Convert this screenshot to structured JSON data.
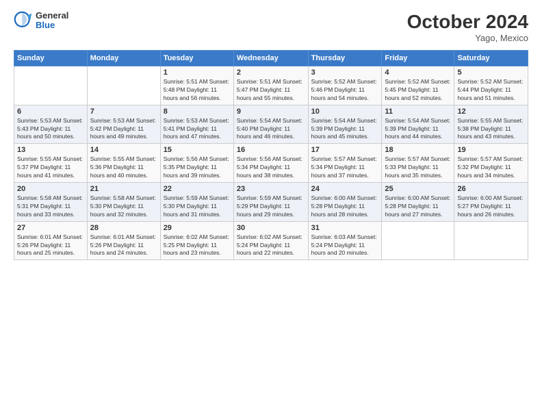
{
  "logo": {
    "general": "General",
    "blue": "Blue"
  },
  "header": {
    "month": "October 2024",
    "location": "Yago, Mexico"
  },
  "weekdays": [
    "Sunday",
    "Monday",
    "Tuesday",
    "Wednesday",
    "Thursday",
    "Friday",
    "Saturday"
  ],
  "weeks": [
    [
      {
        "day": null,
        "info": null
      },
      {
        "day": null,
        "info": null
      },
      {
        "day": "1",
        "info": "Sunrise: 5:51 AM\nSunset: 5:48 PM\nDaylight: 11 hours and 56 minutes."
      },
      {
        "day": "2",
        "info": "Sunrise: 5:51 AM\nSunset: 5:47 PM\nDaylight: 11 hours and 55 minutes."
      },
      {
        "day": "3",
        "info": "Sunrise: 5:52 AM\nSunset: 5:46 PM\nDaylight: 11 hours and 54 minutes."
      },
      {
        "day": "4",
        "info": "Sunrise: 5:52 AM\nSunset: 5:45 PM\nDaylight: 11 hours and 52 minutes."
      },
      {
        "day": "5",
        "info": "Sunrise: 5:52 AM\nSunset: 5:44 PM\nDaylight: 11 hours and 51 minutes."
      }
    ],
    [
      {
        "day": "6",
        "info": "Sunrise: 5:53 AM\nSunset: 5:43 PM\nDaylight: 11 hours and 50 minutes."
      },
      {
        "day": "7",
        "info": "Sunrise: 5:53 AM\nSunset: 5:42 PM\nDaylight: 11 hours and 49 minutes."
      },
      {
        "day": "8",
        "info": "Sunrise: 5:53 AM\nSunset: 5:41 PM\nDaylight: 11 hours and 47 minutes."
      },
      {
        "day": "9",
        "info": "Sunrise: 5:54 AM\nSunset: 5:40 PM\nDaylight: 11 hours and 46 minutes."
      },
      {
        "day": "10",
        "info": "Sunrise: 5:54 AM\nSunset: 5:39 PM\nDaylight: 11 hours and 45 minutes."
      },
      {
        "day": "11",
        "info": "Sunrise: 5:54 AM\nSunset: 5:39 PM\nDaylight: 11 hours and 44 minutes."
      },
      {
        "day": "12",
        "info": "Sunrise: 5:55 AM\nSunset: 5:38 PM\nDaylight: 11 hours and 43 minutes."
      }
    ],
    [
      {
        "day": "13",
        "info": "Sunrise: 5:55 AM\nSunset: 5:37 PM\nDaylight: 11 hours and 41 minutes."
      },
      {
        "day": "14",
        "info": "Sunrise: 5:55 AM\nSunset: 5:36 PM\nDaylight: 11 hours and 40 minutes."
      },
      {
        "day": "15",
        "info": "Sunrise: 5:56 AM\nSunset: 5:35 PM\nDaylight: 11 hours and 39 minutes."
      },
      {
        "day": "16",
        "info": "Sunrise: 5:56 AM\nSunset: 5:34 PM\nDaylight: 11 hours and 38 minutes."
      },
      {
        "day": "17",
        "info": "Sunrise: 5:57 AM\nSunset: 5:34 PM\nDaylight: 11 hours and 37 minutes."
      },
      {
        "day": "18",
        "info": "Sunrise: 5:57 AM\nSunset: 5:33 PM\nDaylight: 11 hours and 35 minutes."
      },
      {
        "day": "19",
        "info": "Sunrise: 5:57 AM\nSunset: 5:32 PM\nDaylight: 11 hours and 34 minutes."
      }
    ],
    [
      {
        "day": "20",
        "info": "Sunrise: 5:58 AM\nSunset: 5:31 PM\nDaylight: 11 hours and 33 minutes."
      },
      {
        "day": "21",
        "info": "Sunrise: 5:58 AM\nSunset: 5:30 PM\nDaylight: 11 hours and 32 minutes."
      },
      {
        "day": "22",
        "info": "Sunrise: 5:59 AM\nSunset: 5:30 PM\nDaylight: 11 hours and 31 minutes."
      },
      {
        "day": "23",
        "info": "Sunrise: 5:59 AM\nSunset: 5:29 PM\nDaylight: 11 hours and 29 minutes."
      },
      {
        "day": "24",
        "info": "Sunrise: 6:00 AM\nSunset: 5:28 PM\nDaylight: 11 hours and 28 minutes."
      },
      {
        "day": "25",
        "info": "Sunrise: 6:00 AM\nSunset: 5:28 PM\nDaylight: 11 hours and 27 minutes."
      },
      {
        "day": "26",
        "info": "Sunrise: 6:00 AM\nSunset: 5:27 PM\nDaylight: 11 hours and 26 minutes."
      }
    ],
    [
      {
        "day": "27",
        "info": "Sunrise: 6:01 AM\nSunset: 5:26 PM\nDaylight: 11 hours and 25 minutes."
      },
      {
        "day": "28",
        "info": "Sunrise: 6:01 AM\nSunset: 5:26 PM\nDaylight: 11 hours and 24 minutes."
      },
      {
        "day": "29",
        "info": "Sunrise: 6:02 AM\nSunset: 5:25 PM\nDaylight: 11 hours and 23 minutes."
      },
      {
        "day": "30",
        "info": "Sunrise: 6:02 AM\nSunset: 5:24 PM\nDaylight: 11 hours and 22 minutes."
      },
      {
        "day": "31",
        "info": "Sunrise: 6:03 AM\nSunset: 5:24 PM\nDaylight: 11 hours and 20 minutes."
      },
      {
        "day": null,
        "info": null
      },
      {
        "day": null,
        "info": null
      }
    ]
  ]
}
